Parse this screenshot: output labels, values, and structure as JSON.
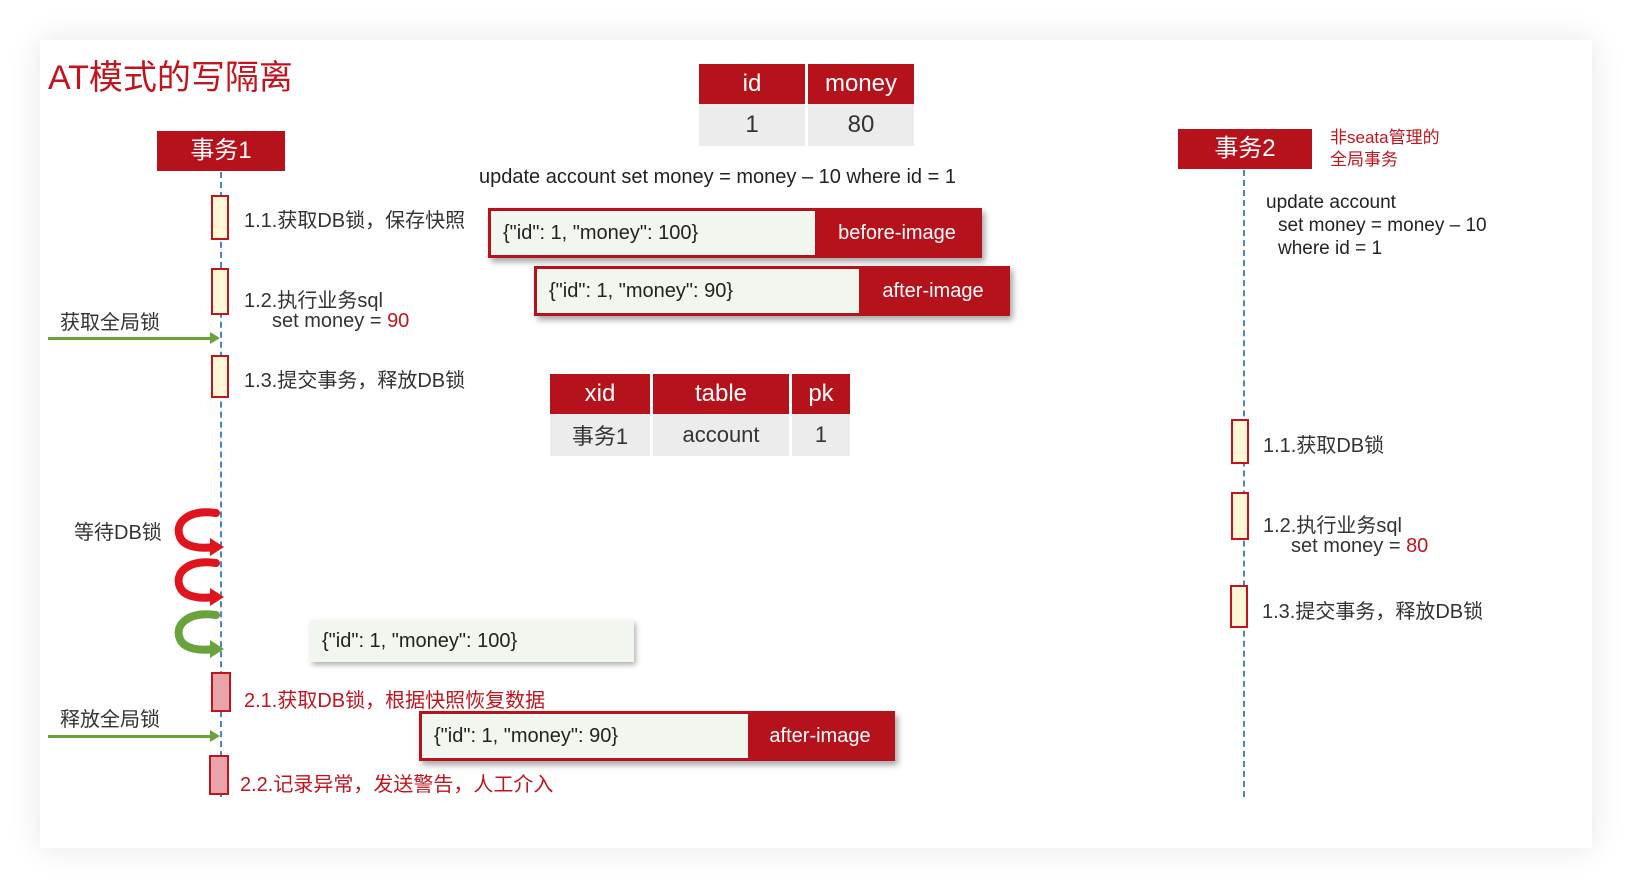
{
  "title": "AT模式的写隔离",
  "tx1": {
    "label": "事务1",
    "steps": {
      "s11": "1.1.获取DB锁，保存快照",
      "s12_line1": "1.2.执行业务sql",
      "s12_line2_prefix": "set money = ",
      "s12_line2_value": "90",
      "s13": "1.3.提交事务，释放DB锁",
      "s21": "2.1.获取DB锁，根据快照恢复数据",
      "s22": "2.2.记录异常，发送警告，人工介入"
    },
    "acquire_global_lock": "获取全局锁",
    "wait_db_lock": "等待DB锁",
    "release_global_lock": "释放全局锁"
  },
  "tx2": {
    "label": "事务2",
    "note_line1": "非seata管理的",
    "note_line2": "全局事务",
    "sql_line1": "update account",
    "sql_line2": "set money = money – 10",
    "sql_line3": "where id = 1",
    "steps": {
      "s11": "1.1.获取DB锁",
      "s12_line1": "1.2.执行业务sql",
      "s12_line2_prefix": "set money = ",
      "s12_line2_value": "80",
      "s13": "1.3.提交事务，释放DB锁"
    }
  },
  "account_table": {
    "headers": [
      "id",
      "money"
    ],
    "row": [
      "1",
      "80"
    ]
  },
  "update_sql": "update account set money = money – 10 where id = 1",
  "before_image": {
    "json": "{\"id\": 1, \"money\": 100}",
    "label": "before-image"
  },
  "after_image": {
    "json": "{\"id\": 1, \"money\": 90}",
    "label": "after-image"
  },
  "lock_table": {
    "headers": [
      "xid",
      "table",
      "pk"
    ],
    "row": [
      "事务1",
      "account",
      "1"
    ]
  },
  "restore_json": "{\"id\": 1, \"money\": 100}",
  "after_image_2": {
    "json": "{\"id\": 1, \"money\": 90}",
    "label": "after-image"
  },
  "colors": {
    "brand_red": "#b5121b",
    "green": "#6aa23c",
    "lifeline_blue": "#4a84c9"
  }
}
